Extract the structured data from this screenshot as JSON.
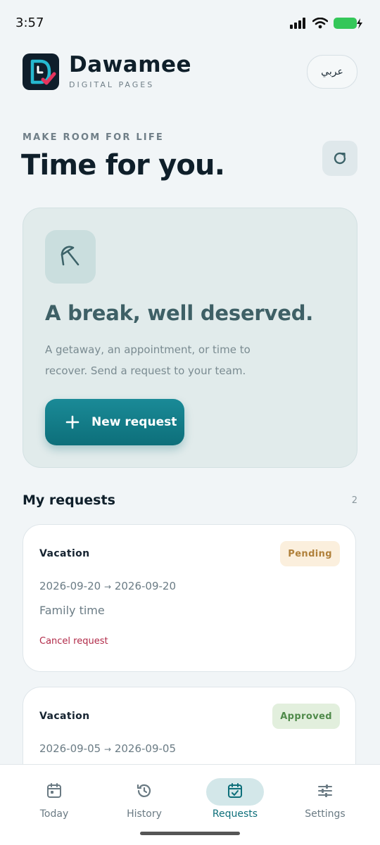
{
  "status_bar": {
    "time": "3:57"
  },
  "header": {
    "brand_name": "Dawamee",
    "brand_subtitle": "DIGITAL PAGES",
    "language_button": "عربي"
  },
  "hero": {
    "eyebrow": "MAKE ROOM FOR LIFE",
    "title": "Time for you."
  },
  "break_card": {
    "title": "A break, well deserved.",
    "description": "A getaway, an appointment, or time to recover. Send a request to your team.",
    "button_label": "New request",
    "icon": "umbrella-icon"
  },
  "requests": {
    "title": "My requests",
    "count": "2",
    "items": [
      {
        "type": "Vacation",
        "status": "Pending",
        "start": "2026-09-20",
        "arrow": "→",
        "end": "2026-09-20",
        "note": "Family time",
        "action": "Cancel request"
      },
      {
        "type": "Vacation",
        "status": "Approved",
        "start": "2026-09-05",
        "arrow": "→",
        "end": "2026-09-05"
      }
    ]
  },
  "tabs": [
    {
      "label": "Today",
      "icon": "calendar-icon"
    },
    {
      "label": "History",
      "icon": "history-icon"
    },
    {
      "label": "Requests",
      "icon": "calendar-check-icon",
      "active": true
    },
    {
      "label": "Settings",
      "icon": "sliders-icon"
    }
  ],
  "colors": {
    "accent": "#0d6f7a",
    "pending": "#b0803a",
    "approved": "#4f8a4a",
    "danger": "#b12a48"
  }
}
